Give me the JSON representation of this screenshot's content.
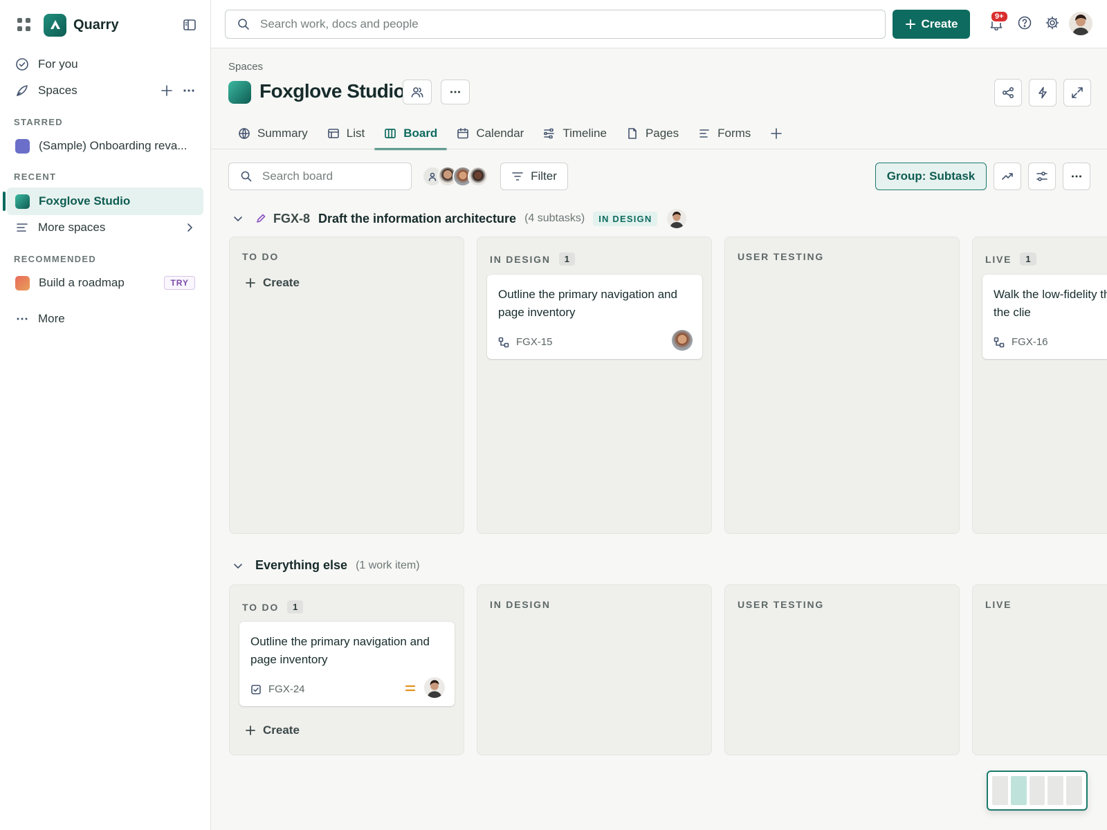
{
  "app": {
    "name": "Quarry"
  },
  "sidebar": {
    "for_you": "For you",
    "spaces": "Spaces",
    "starred_heading": "STARRED",
    "starred": [
      {
        "label": "(Sample) Onboarding reva...",
        "color": "#6b6fc9"
      }
    ],
    "recent_heading": "RECENT",
    "recent": [
      {
        "label": "Foxglove Studio"
      }
    ],
    "more_spaces": "More spaces",
    "recommended_heading": "RECOMMENDED",
    "recommended": [
      {
        "label": "Build a roadmap",
        "badge": "TRY"
      }
    ],
    "more": "More"
  },
  "topbar": {
    "search_placeholder": "Search work, docs and people",
    "create_label": "Create",
    "notifications_badge": "9+"
  },
  "header": {
    "breadcrumb": "Spaces",
    "title": "Foxglove Studio",
    "tabs": [
      {
        "label": "Summary",
        "icon": "globe-icon"
      },
      {
        "label": "List",
        "icon": "list-icon"
      },
      {
        "label": "Board",
        "icon": "board-icon",
        "active": true
      },
      {
        "label": "Calendar",
        "icon": "calendar-icon"
      },
      {
        "label": "Timeline",
        "icon": "timeline-icon"
      },
      {
        "label": "Pages",
        "icon": "page-icon"
      },
      {
        "label": "Forms",
        "icon": "forms-icon"
      }
    ]
  },
  "toolbar": {
    "search_placeholder": "Search board",
    "filter_label": "Filter",
    "group_label": "Group: Subtask"
  },
  "groups": [
    {
      "key": "FGX-8",
      "title": "Draft the information architecture",
      "subtitle": "(4 subtasks)",
      "status": "IN DESIGN",
      "columns": [
        {
          "title": "TO DO",
          "count": "",
          "create_label": "Create"
        },
        {
          "title": "IN DESIGN",
          "count": "1",
          "card": {
            "title": "Outline the primary navigation and page inventory",
            "key": "FGX-15"
          }
        },
        {
          "title": "USER TESTING",
          "count": ""
        },
        {
          "title": "LIVE",
          "count": "1",
          "card": {
            "title": "Walk the low-fidelity through with the clie",
            "key": "FGX-16"
          }
        }
      ]
    },
    {
      "title": "Everything else",
      "subtitle": "(1 work item)",
      "columns": [
        {
          "title": "TO DO",
          "count": "1",
          "create_label": "Create",
          "card": {
            "title": "Outline the primary navigation and page inventory",
            "key": "FGX-24"
          }
        },
        {
          "title": "IN DESIGN",
          "count": ""
        },
        {
          "title": "USER TESTING",
          "count": ""
        },
        {
          "title": "LIVE",
          "count": ""
        }
      ]
    }
  ],
  "colors": {
    "accent": "#0e6b5f",
    "accent_light": "#e6f2ef",
    "badge_red": "#d92e2e",
    "priority_medium": "#e2931b"
  }
}
